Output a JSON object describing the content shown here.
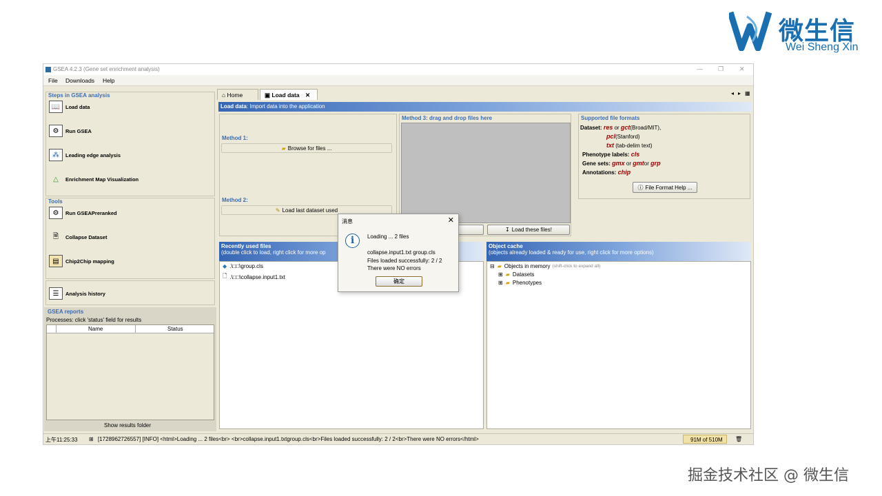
{
  "brand": {
    "cn": "微生信",
    "en": "Wei Sheng Xin",
    "watermark": "掘金技术社区 @ 微生信"
  },
  "window": {
    "title": "GSEA 4.2.3 (Gene set enrichment analysis)",
    "menu": [
      "File",
      "Downloads",
      "Help"
    ]
  },
  "steps": {
    "title": "Steps in GSEA analysis",
    "items": [
      {
        "label": "Load data",
        "icon": "book-icon"
      },
      {
        "label": "Run GSEA",
        "icon": "gear-icon"
      },
      {
        "label": "Leading edge analysis",
        "icon": "cluster-icon"
      },
      {
        "label": "Enrichment Map Visualization",
        "icon": "triangle-icon"
      }
    ]
  },
  "tools": {
    "title": "Tools",
    "items": [
      {
        "label": "Run GSEAPreranked",
        "icon": "gear-icon"
      },
      {
        "label": "Collapse Dataset",
        "icon": "document-icon"
      },
      {
        "label": "Chip2Chip mapping",
        "icon": "chip-icon"
      }
    ]
  },
  "history": {
    "label": "Analysis history"
  },
  "reports": {
    "title": "GSEA reports",
    "subtitle": "Processes: click 'status' field for results",
    "columns": [
      "Name",
      "Status"
    ],
    "show_folder": "Show results folder"
  },
  "tabs": [
    "Home",
    "Load data"
  ],
  "load": {
    "header_bold": "Load data",
    "header_rest": ": Import data into the application",
    "method1_title": "Method 1:",
    "browse": "Browse for files ...",
    "method2_title": "Method 2:",
    "load_last": "Load last dataset used",
    "method3_title": "Method 3: drag and drop files here",
    "load_these": "Load these files!"
  },
  "formats": {
    "title": "Supported file formats",
    "dataset_label": "Dataset:",
    "res": "res",
    "or1": "or",
    "gct": "gct",
    "broad": "(Broad/MIT),",
    "pcl": "pcl",
    "stanford": "(Stanford)",
    "txt": "txt",
    "tabdelim": "(tab-delim text)",
    "phenotype_label": "Phenotype labels:",
    "cls": "cls",
    "genesets_label": "Gene sets:",
    "gmx": "gmx",
    "or2": "or",
    "gmt": "gmt",
    "or3": "or",
    "grp": "grp",
    "annotations_label": "Annotations:",
    "chip": "chip",
    "help_button": "File Format Help ..."
  },
  "recent": {
    "title": "Recently used files",
    "subtitle": "(double click to load, right click for more op",
    "files": [
      ".\\□□\\group.cls",
      ".\\□□\\collapse.input1.txt"
    ]
  },
  "cache": {
    "title": "Object cache",
    "subtitle": "(objects already loaded & ready for use, right click for more options)",
    "root": "Objects in memory",
    "root_hint": "(shift-click to expand all)",
    "children": [
      "Datasets",
      "Phenotypes"
    ]
  },
  "dialog": {
    "title": "消息",
    "line1": "Loading ... 2 files",
    "line2": "collapse.input1.txt group.cls",
    "line3": "Files loaded successfully: 2 / 2",
    "line4": "There were NO errors",
    "ok": "确定"
  },
  "status": {
    "time": "上午11:25:33",
    "log": "[1728962726557] [INFO] <html>Loading ... 2 files<br> <br>collapse.input1.txtgroup.cls<br>Files loaded successfully: 2 / 2<br>There were NO errors</html>",
    "memory": "91M of 510M"
  },
  "colors": {
    "accent": "#3a6bb5",
    "format_red": "#a40000",
    "panel_bg": "#ece9d8"
  }
}
